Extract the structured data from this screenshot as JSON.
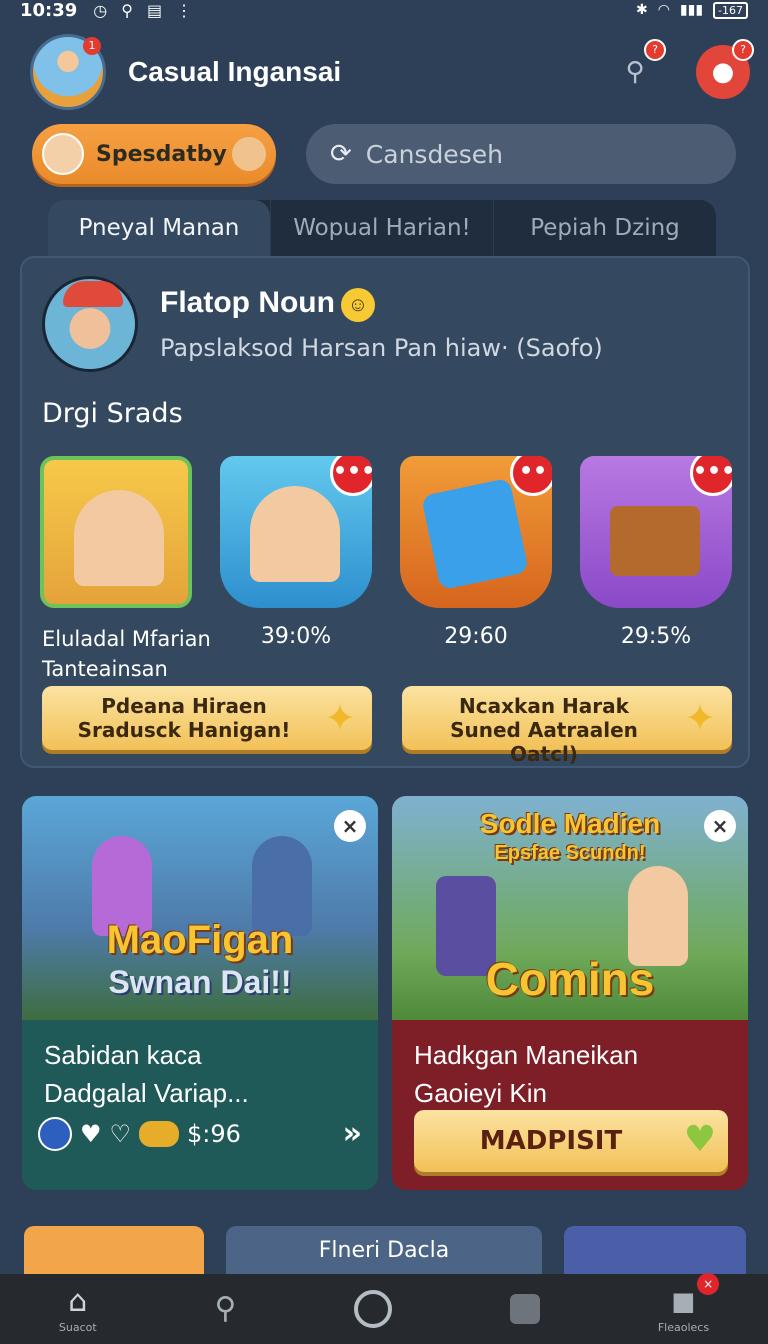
{
  "status_bar": {
    "time": "10:39",
    "battery": "-167"
  },
  "header": {
    "app_title": "Casual Ingansai",
    "avatar_badge": "1",
    "search_badge": "?",
    "profile_badge": "?"
  },
  "chip": {
    "label": "Spesdatby"
  },
  "search": {
    "placeholder": "Cansdeseh"
  },
  "tabs": [
    {
      "label": "Pneyal Manan"
    },
    {
      "label": "Wopual Harian!"
    },
    {
      "label": "Pepiah Dzing"
    }
  ],
  "profile": {
    "name": "Flatop Noun",
    "subtitle": "Papslaksod Harsan Pan hiaw· (Saofo)"
  },
  "section": {
    "title": "Drgi Srads"
  },
  "tiles": [
    {
      "caption_line1": "Eluladal Mfarian",
      "caption_line2": "Tanteainsan"
    },
    {
      "caption": "39:0%",
      "dot": "•••"
    },
    {
      "caption": "29:60",
      "dot": "••"
    },
    {
      "caption": "29:5%",
      "dot": "•••"
    }
  ],
  "gold_buttons": [
    {
      "line1": "Pdeana Hiraen",
      "line2": "Sradusck Hanigan!"
    },
    {
      "line1": "Ncaxkan Harak",
      "line2": "Suned Aatraalen Oatcl)"
    }
  ],
  "promos": [
    {
      "art_title": "MaoFigan",
      "art_subtitle": "Swnan Dai!!",
      "title_line1": "Sabidan kaca",
      "title_line2": "Dadgalal Variap...",
      "amount": "$:96",
      "chev": "»",
      "close": "×"
    },
    {
      "art_title": "Sodle Madien",
      "art_subtitle": "Epsfae Scundn!",
      "art_big": "Comins",
      "title_line1": "Hadkgan Maneikan",
      "title_line2": "Gaoieyi Kin",
      "button": "MADPISIT",
      "close": "×"
    }
  ],
  "partial_row": {
    "middle_label": "Flneri Dacla"
  },
  "bottom_nav": [
    {
      "label": "Suacot",
      "icon": "home-icon"
    },
    {
      "label": "",
      "icon": "search-icon"
    },
    {
      "label": "",
      "icon": "circle-icon"
    },
    {
      "label": "",
      "icon": "square-icon"
    },
    {
      "label": "Fleaolecs",
      "icon": "profile-icon",
      "badge": "×"
    }
  ]
}
